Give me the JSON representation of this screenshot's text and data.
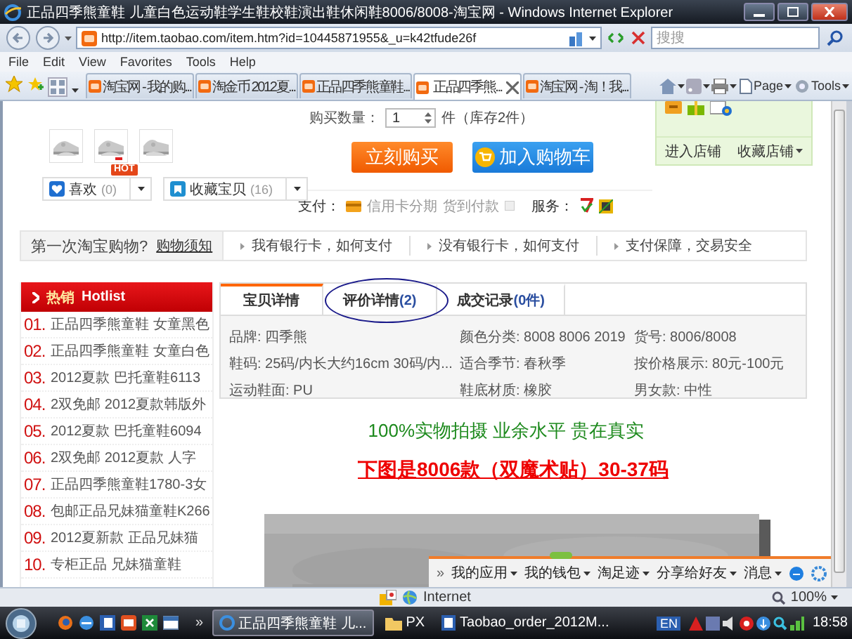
{
  "window": {
    "title": "正品四季熊童鞋 儿童白色运动鞋学生鞋校鞋演出鞋休闲鞋8006/8008-淘宝网 - Windows Internet Explorer"
  },
  "address_bar": {
    "url": "http://item.taobao.com/item.htm?id=10445871955&_u=k42tfude26f",
    "search_placeholder": "搜搜"
  },
  "menu": [
    "File",
    "Edit",
    "View",
    "Favorites",
    "Tools",
    "Help"
  ],
  "browser_tabs": [
    {
      "title": "淘宝网 - 我的购...",
      "selected": false
    },
    {
      "title": "淘金币 2012夏...",
      "selected": false
    },
    {
      "title": "正品四季熊童鞋...",
      "selected": false
    },
    {
      "title": "正品四季熊...",
      "selected": true
    },
    {
      "title": "淘宝网 - 淘！我...",
      "selected": false
    }
  ],
  "command_bar": [
    "Page",
    "Tools"
  ],
  "page": {
    "quantity": {
      "label": "购买数量：",
      "value": "1",
      "unit": "件（库存2件）"
    },
    "buy_buttons": [
      {
        "kind": "buy",
        "label": "立刻购买"
      },
      {
        "kind": "cart",
        "label": "加入购物车"
      }
    ],
    "hot_badge": "HOT",
    "actions": [
      {
        "kind": "like",
        "label": "喜欢",
        "count": "(0)"
      },
      {
        "kind": "collect",
        "label": "收藏宝贝",
        "count": "(16)"
      }
    ],
    "payment": {
      "label": "支付：",
      "options": [
        "信用卡分期",
        "货到付款"
      ],
      "service_label": "服务："
    },
    "shop_links": [
      "进入店铺",
      "收藏店铺"
    ],
    "info_bar": {
      "question": "第一次淘宝购物?",
      "link": "购物须知",
      "items": [
        "我有银行卡，如何支付",
        "没有银行卡，如何支付",
        "支付保障，交易安全"
      ]
    },
    "hotlist": {
      "title": "热销",
      "subtitle": "Hotlist",
      "items": [
        {
          "number": "01.",
          "text": "正品四季熊童鞋 女童黑色"
        },
        {
          "number": "02.",
          "text": "正品四季熊童鞋 女童白色"
        },
        {
          "number": "03.",
          "text": "2012夏款 巴托童鞋6113"
        },
        {
          "number": "04.",
          "text": "2双免邮 2012夏款韩版外"
        },
        {
          "number": "05.",
          "text": "2012夏款 巴托童鞋6094"
        },
        {
          "number": "06.",
          "text": "2双免邮 2012夏款 人字"
        },
        {
          "number": "07.",
          "text": "正品四季熊童鞋1780-3女"
        },
        {
          "number": "08.",
          "text": "包邮正品兄妹猫童鞋K266"
        },
        {
          "number": "09.",
          "text": "2012夏新款 正品兄妹猫"
        },
        {
          "number": "10.",
          "text": "专柜正品 兄妹猫童鞋"
        }
      ]
    },
    "detail_tabs": [
      {
        "label": "宝贝详情",
        "selected": true,
        "circled": false
      },
      {
        "label": "评价详情",
        "count": "(2)",
        "selected": false,
        "circled": true
      },
      {
        "label": "成交记录",
        "count": "(0件)",
        "selected": false,
        "circled": false
      }
    ],
    "attributes": [
      {
        "label": "品牌:",
        "value": "四季熊"
      },
      {
        "label": "颜色分类:",
        "value": "8008 8006 2019"
      },
      {
        "label": "货号:",
        "value": "8006/8008"
      },
      {
        "label": "鞋码:",
        "value": "25码/内长大约16cm 30码/内..."
      },
      {
        "label": "适合季节:",
        "value": "春秋季"
      },
      {
        "label": "按价格展示:",
        "value": "80元-100元"
      },
      {
        "label": "运动鞋面:",
        "value": "PU"
      },
      {
        "label": "鞋底材质:",
        "value": "橡胶"
      },
      {
        "label": "男女款:",
        "value": "中性"
      }
    ],
    "headlines": [
      {
        "kind": "note",
        "text": "100%实物拍摄 业余水平 贵在真实"
      },
      {
        "kind": "heading",
        "text": "下图是8006款（双魔术贴）30-37码"
      }
    ],
    "toolbar": {
      "overflow": "»",
      "items": [
        "我的应用",
        "我的钱包",
        "淘足迹",
        "分享给好友",
        "消息"
      ]
    }
  },
  "status_bar": {
    "zone": "Internet",
    "zoom": "100%"
  },
  "taskbar": {
    "overflow": "»",
    "tasks": [
      {
        "title": "正品四季熊童鞋 儿...",
        "selected": true
      },
      {
        "title": "PX",
        "selected": false
      },
      {
        "title": "Taobao_order_2012M...",
        "selected": false
      }
    ],
    "language": "EN",
    "clock": "18:58"
  }
}
